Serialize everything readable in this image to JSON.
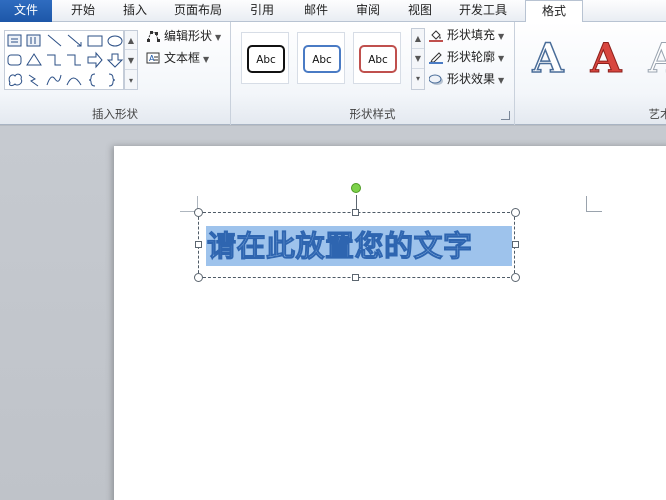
{
  "tabs": [
    {
      "label": "文件",
      "kind": "file"
    },
    {
      "label": "开始"
    },
    {
      "label": "插入"
    },
    {
      "label": "页面布局"
    },
    {
      "label": "引用"
    },
    {
      "label": "邮件"
    },
    {
      "label": "审阅"
    },
    {
      "label": "视图"
    },
    {
      "label": "开发工具"
    },
    {
      "label": "格式",
      "active": true
    }
  ],
  "ribbon": {
    "insert_shapes": {
      "label": "插入形状",
      "edit_shape": "编辑形状",
      "text_box": "文本框"
    },
    "shape_styles": {
      "label": "形状样式",
      "tiles": [
        "Abc",
        "Abc",
        "Abc"
      ],
      "tile_colors": [
        "#111111",
        "#4a7bc4",
        "#c0504d"
      ],
      "fill": "形状填充",
      "outline": "形状轮廓",
      "effects": "形状效果"
    },
    "wordart": {
      "label": "艺术字样式",
      "letters": [
        "A",
        "A",
        "A"
      ]
    }
  },
  "document": {
    "textbox_text": "请在此放置您的文字"
  },
  "colors": {
    "file_tab": "#1d57a8",
    "selection_fill": "#9ec3ec",
    "rotate_handle": "#7dd24a"
  }
}
